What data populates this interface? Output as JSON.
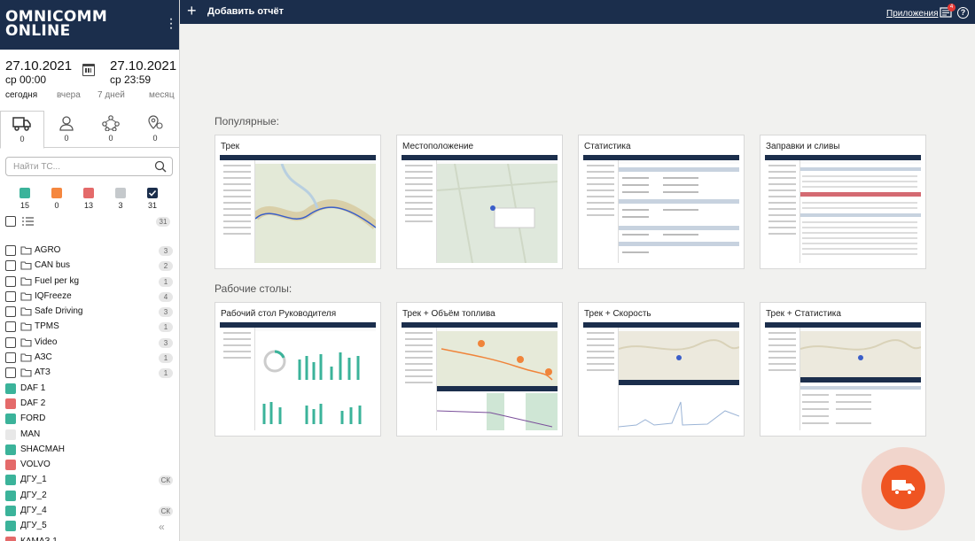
{
  "brand": {
    "line1": "OMNICOMM",
    "line2": "ONLINE"
  },
  "colors": {
    "navy": "#1b2e4c",
    "green": "#3bb39a",
    "orange": "#f5873f",
    "red": "#e46a6a",
    "grey": "#c5c9cc",
    "fab": "#ef5422"
  },
  "date_range": {
    "from_date": "27.10.2021",
    "from_time": "ср 00:00",
    "to_date": "27.10.2021",
    "to_time": "ср 23:59",
    "periods": [
      "сегодня",
      "вчера",
      "7 дней",
      "месяц"
    ],
    "active_period": "сегодня"
  },
  "object_tabs": [
    {
      "icon": "truck-icon",
      "count": "0"
    },
    {
      "icon": "person-icon",
      "count": "0"
    },
    {
      "icon": "network-icon",
      "count": "0"
    },
    {
      "icon": "geo-pin-icon",
      "count": "0"
    }
  ],
  "search": {
    "placeholder": "Найти ТС..."
  },
  "status_filters": [
    {
      "color": "#3bb39a",
      "count": "15"
    },
    {
      "color": "#f5873f",
      "count": "0"
    },
    {
      "color": "#e46a6a",
      "count": "13"
    },
    {
      "color": "#c5c9cc",
      "count": "3"
    },
    {
      "color": "#1b2e4c",
      "count": "31",
      "checked": true
    }
  ],
  "list_header": {
    "total": "31"
  },
  "groups": [
    {
      "name": "AGRO",
      "count": "3"
    },
    {
      "name": "CAN bus",
      "count": "2"
    },
    {
      "name": "Fuel per kg",
      "count": "1"
    },
    {
      "name": "IQFreeze",
      "count": "4"
    },
    {
      "name": "Safe Driving",
      "count": "3"
    },
    {
      "name": "TPMS",
      "count": "1"
    },
    {
      "name": "Video",
      "count": "3"
    },
    {
      "name": "АЗС",
      "count": "1"
    },
    {
      "name": "АТЗ",
      "count": "1"
    }
  ],
  "vehicles": [
    {
      "name": "DAF 1",
      "color": "#3bb39a",
      "badge": ""
    },
    {
      "name": "DAF 2",
      "color": "#e46a6a",
      "badge": ""
    },
    {
      "name": "FORD",
      "color": "#3bb39a",
      "badge": ""
    },
    {
      "name": "MAN",
      "color": "#e8e8e8",
      "badge": ""
    },
    {
      "name": "SHACMAH",
      "color": "#3bb39a",
      "badge": ""
    },
    {
      "name": "VOLVO",
      "color": "#e46a6a",
      "badge": ""
    },
    {
      "name": "ДГУ_1",
      "color": "#3bb39a",
      "badge": "СК"
    },
    {
      "name": "ДГУ_2",
      "color": "#3bb39a",
      "badge": ""
    },
    {
      "name": "ДГУ_4",
      "color": "#3bb39a",
      "badge": "СК"
    },
    {
      "name": "ДГУ_5",
      "color": "#3bb39a",
      "badge": ""
    },
    {
      "name": "КАМАЗ 1",
      "color": "#e46a6a",
      "badge": ""
    }
  ],
  "topbar": {
    "add_report": "Добавить отчёт",
    "apps": "Приложения",
    "notifications": "4",
    "help": "?"
  },
  "sections": {
    "popular": "Популярные:",
    "dashboards": "Рабочие столы:"
  },
  "popular_cards": [
    "Трек",
    "Местоположение",
    "Статистика",
    "Заправки и сливы"
  ],
  "dashboard_cards": [
    "Рабочий стол Руководителя",
    "Трек + Объём топлива",
    "Трек + Скорость",
    "Трек + Статистика"
  ]
}
